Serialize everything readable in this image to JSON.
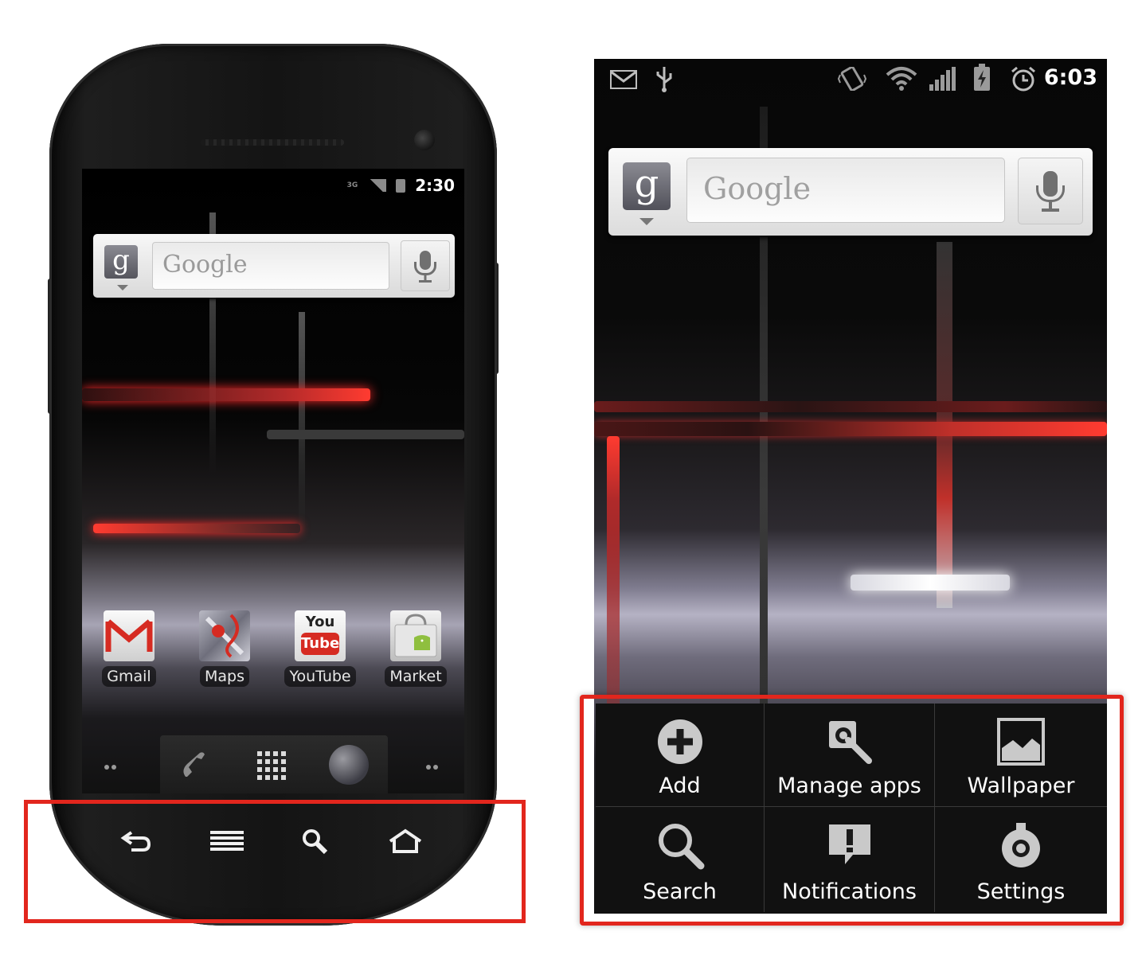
{
  "left_phone": {
    "status_time": "2:30",
    "network_label": "3G",
    "search_widget": {
      "placeholder": "Google",
      "g_letter": "g"
    },
    "apps": [
      {
        "label": "Gmail",
        "icon": "gmail-icon"
      },
      {
        "label": "Maps",
        "icon": "maps-icon"
      },
      {
        "label": "YouTube",
        "icon": "youtube-icon"
      },
      {
        "label": "Market",
        "icon": "market-icon"
      }
    ],
    "youtube_icon_text": [
      "You",
      "Tube"
    ],
    "dock": [
      "phone-icon",
      "app-drawer-icon",
      "browser-globe-icon"
    ],
    "softkeys": [
      "back-icon",
      "menu-icon",
      "search-icon",
      "home-icon"
    ]
  },
  "right_screen": {
    "status_time": "6:03",
    "status_icons": [
      "gmail-notification-icon",
      "usb-icon",
      "vibrate-icon",
      "wifi-icon",
      "signal-icon",
      "battery-charging-icon",
      "alarm-icon"
    ],
    "search_widget": {
      "placeholder": "Google",
      "g_letter": "g"
    },
    "menu": [
      {
        "label": "Add",
        "icon": "add-icon"
      },
      {
        "label": "Manage apps",
        "icon": "manage-apps-icon"
      },
      {
        "label": "Wallpaper",
        "icon": "wallpaper-icon"
      },
      {
        "label": "Search",
        "icon": "search-icon"
      },
      {
        "label": "Notifications",
        "icon": "notifications-icon"
      },
      {
        "label": "Settings",
        "icon": "settings-icon"
      }
    ]
  },
  "colors": {
    "highlight": "#e2261d",
    "accent_red": "#e8302a",
    "menu_bg": "#111111"
  }
}
